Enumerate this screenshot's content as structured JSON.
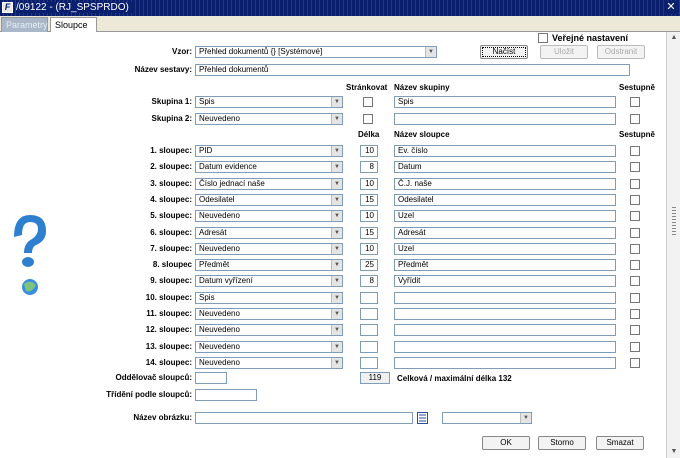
{
  "window": {
    "title": "/09122 - (RJ_SPSPRDO)",
    "close": "✕",
    "icon_letter": "F"
  },
  "tabs": [
    {
      "label": "Parametry",
      "active": false
    },
    {
      "label": "Sloupce",
      "active": true
    }
  ],
  "top": {
    "public_label": "Veřejné nastavení",
    "vzor_label": "Vzor:",
    "vzor_value": "Přehled dokumentů   {}   [Systémové]",
    "nacist_label": "Načíst",
    "ulozit_label": "Uložit",
    "odstranit_label": "Odstranit",
    "nazev_sestavy_label": "Název sestavy:",
    "nazev_sestavy_value": "Přehled dokumentů"
  },
  "groups": {
    "hdr_strankovat": "Stránkovat",
    "hdr_nazev_skupiny": "Název skupiny",
    "hdr_sestupne": "Sestupně",
    "rows": [
      {
        "label": "Skupina 1:",
        "value": "Spis",
        "name": "Spis"
      },
      {
        "label": "Skupina 2:",
        "value": "Neuvedeno",
        "name": ""
      }
    ]
  },
  "columns": {
    "hdr_delka": "Délka",
    "hdr_nazev_sloupce": "Název sloupce",
    "hdr_sestupne": "Sestupně",
    "rows": [
      {
        "label": "1. sloupec:",
        "value": "PID",
        "length": "10",
        "name": "Ev. číslo"
      },
      {
        "label": "2. sloupec:",
        "value": "Datum evidence",
        "length": "8",
        "name": "Datum"
      },
      {
        "label": "3. sloupec:",
        "value": "Číslo jednací naše",
        "length": "10",
        "name": "Č.J. naše"
      },
      {
        "label": "4. sloupec:",
        "value": "Odesilatel",
        "length": "15",
        "name": "Odesilatel"
      },
      {
        "label": "5. sloupec:",
        "value": "Neuvedeno",
        "length": "10",
        "name": "Uzel"
      },
      {
        "label": "6. sloupec:",
        "value": "Adresát",
        "length": "15",
        "name": "Adresát"
      },
      {
        "label": "7. sloupec:",
        "value": "Neuvedeno",
        "length": "10",
        "name": "Uzel"
      },
      {
        "label": "8. sloupec",
        "value": "Předmět",
        "length": "25",
        "name": "Předmět"
      },
      {
        "label": "9. sloupec:",
        "value": "Datum vyřízení",
        "length": "8",
        "name": "Vyřídit"
      },
      {
        "label": "10. sloupec:",
        "value": "Spis",
        "length": "",
        "name": ""
      },
      {
        "label": "11. sloupec:",
        "value": "Neuvedeno",
        "length": "",
        "name": ""
      },
      {
        "label": "12. sloupec:",
        "value": "Neuvedeno",
        "length": "",
        "name": ""
      },
      {
        "label": "13. sloupec:",
        "value": "Neuvedeno",
        "length": "",
        "name": ""
      },
      {
        "label": "14. sloupec:",
        "value": "Neuvedeno",
        "length": "",
        "name": ""
      }
    ]
  },
  "bottom": {
    "separator_label": "Oddělovač sloupců:",
    "total_value": "119",
    "total_text": "Celková / maximální délka 132",
    "sort_label": "Třídění podle sloupců:",
    "image_label": "Název obrázku:",
    "ok_label": "OK",
    "storno_label": "Storno",
    "smazat_label": "Smazat"
  },
  "colors": {
    "titlebar": "#0a1f6e",
    "accent": "#7f9db9"
  }
}
